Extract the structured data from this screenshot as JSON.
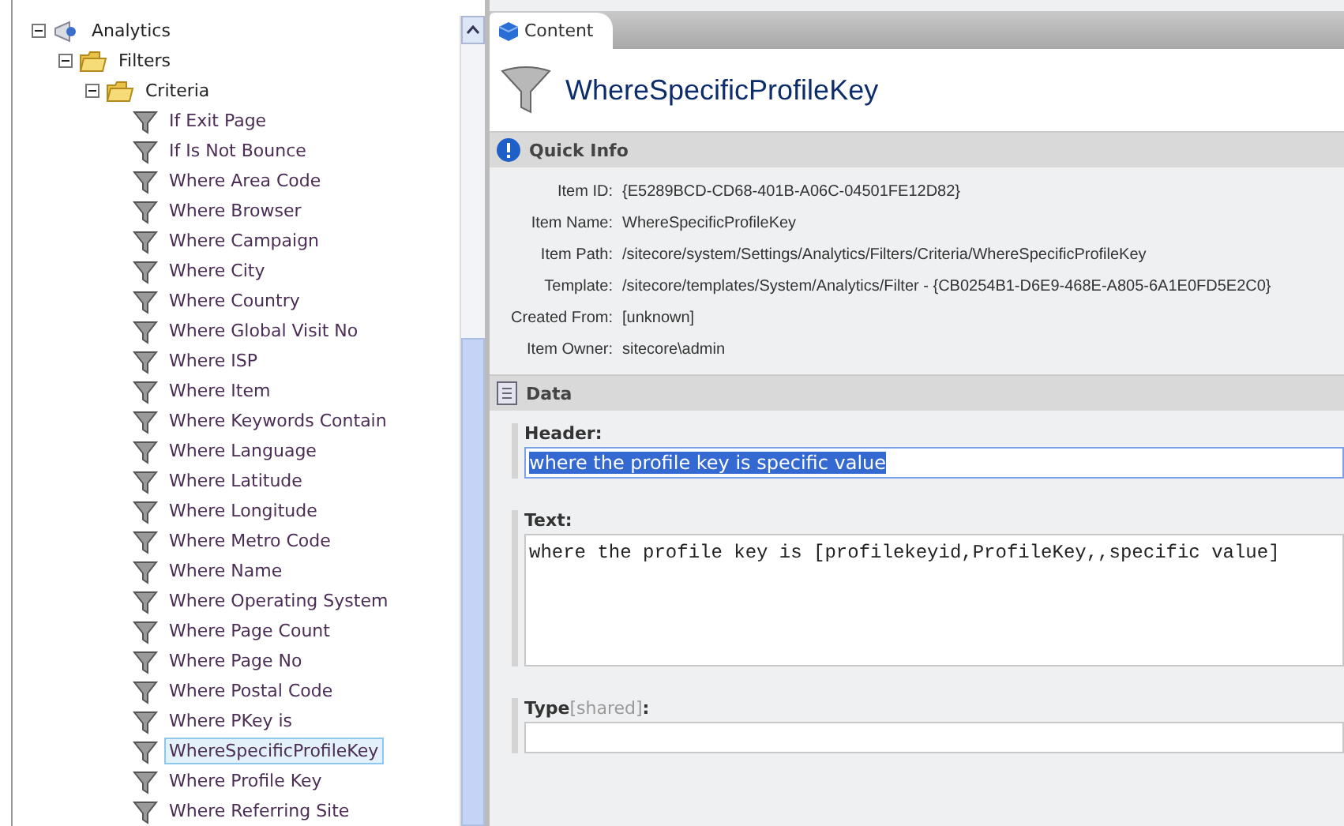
{
  "tree": [
    {
      "label": "Analytics",
      "kind": "analytics",
      "expanded": true,
      "selected": false,
      "children": [
        {
          "label": "Filters",
          "kind": "folder",
          "expanded": true,
          "selected": false,
          "children": [
            {
              "label": "Criteria",
              "kind": "folder",
              "expanded": true,
              "selected": false,
              "children": [
                {
                  "label": "If Exit Page",
                  "kind": "filter",
                  "selected": false
                },
                {
                  "label": "If Is Not Bounce",
                  "kind": "filter",
                  "selected": false
                },
                {
                  "label": "Where Area Code",
                  "kind": "filter",
                  "selected": false
                },
                {
                  "label": "Where Browser",
                  "kind": "filter",
                  "selected": false
                },
                {
                  "label": "Where Campaign",
                  "kind": "filter",
                  "selected": false
                },
                {
                  "label": "Where City",
                  "kind": "filter",
                  "selected": false
                },
                {
                  "label": "Where Country",
                  "kind": "filter",
                  "selected": false
                },
                {
                  "label": "Where Global Visit No",
                  "kind": "filter",
                  "selected": false
                },
                {
                  "label": "Where ISP",
                  "kind": "filter",
                  "selected": false
                },
                {
                  "label": "Where Item",
                  "kind": "filter",
                  "selected": false
                },
                {
                  "label": "Where Keywords Contain",
                  "kind": "filter",
                  "selected": false
                },
                {
                  "label": "Where Language",
                  "kind": "filter",
                  "selected": false
                },
                {
                  "label": "Where Latitude",
                  "kind": "filter",
                  "selected": false
                },
                {
                  "label": "Where Longitude",
                  "kind": "filter",
                  "selected": false
                },
                {
                  "label": "Where Metro Code",
                  "kind": "filter",
                  "selected": false
                },
                {
                  "label": "Where Name",
                  "kind": "filter",
                  "selected": false
                },
                {
                  "label": "Where Operating System",
                  "kind": "filter",
                  "selected": false
                },
                {
                  "label": "Where Page Count",
                  "kind": "filter",
                  "selected": false
                },
                {
                  "label": "Where Page No",
                  "kind": "filter",
                  "selected": false
                },
                {
                  "label": "Where Postal Code",
                  "kind": "filter",
                  "selected": false
                },
                {
                  "label": "Where PKey is",
                  "kind": "filter",
                  "selected": false
                },
                {
                  "label": "WhereSpecificProfileKey",
                  "kind": "filter",
                  "selected": true
                },
                {
                  "label": "Where Profile Key",
                  "kind": "filter",
                  "selected": false
                },
                {
                  "label": "Where Referring Site",
                  "kind": "filter",
                  "selected": false
                }
              ]
            }
          ]
        }
      ]
    }
  ],
  "tabs": [
    {
      "label": "Content",
      "selected": true
    }
  ],
  "item_title": "WhereSpecificProfileKey",
  "quick_info": {
    "title": "Quick Info",
    "rows": [
      {
        "label": "Item ID:",
        "value": "{E5289BCD-CD68-401B-A06C-04501FE12D82}"
      },
      {
        "label": "Item Name:",
        "value": "WhereSpecificProfileKey"
      },
      {
        "label": "Item Path:",
        "value": "/sitecore/system/Settings/Analytics/Filters/Criteria/WhereSpecificProfileKey"
      },
      {
        "label": "Template:",
        "value": "/sitecore/templates/System/Analytics/Filter - {CB0254B1-D6E9-468E-A805-6A1E0FD5E2C0}"
      },
      {
        "label": "Created From:",
        "value": "[unknown]"
      },
      {
        "label": "Item Owner:",
        "value": "sitecore\\admin"
      }
    ]
  },
  "data_section": {
    "title": "Data",
    "fields": [
      {
        "label": "Header:",
        "kind": "line",
        "value": "where the profile key is specific value",
        "highlighted": true
      },
      {
        "label": "Text:",
        "kind": "memo",
        "value": "where the profile key is [profilekeyid,ProfileKey,,specific value]"
      },
      {
        "label": "Type",
        "note": "[shared]",
        "suffix": ":",
        "kind": "line"
      }
    ]
  }
}
